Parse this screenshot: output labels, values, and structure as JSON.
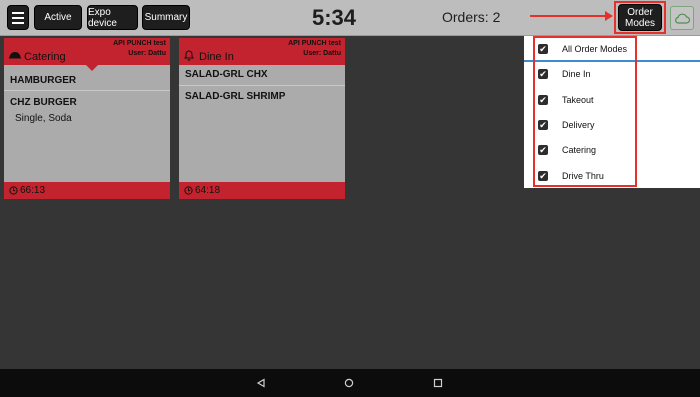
{
  "topbar": {
    "buttons": {
      "active": "Active",
      "expo": "Expo device",
      "summary": "Summary"
    },
    "clock": "5:34",
    "orders": "Orders: 2",
    "order_modes_line1": "Order",
    "order_modes_line2": "Modes"
  },
  "cards": [
    {
      "store": "API PUNCH test",
      "user": "User: Dattu",
      "mode": "Catering",
      "mode_icon": "catering-cloche-icon",
      "items": [
        {
          "name": "HAMBURGER"
        },
        {
          "name": "CHZ BURGER",
          "modifier": "Single, Soda"
        }
      ],
      "timer": "66:13"
    },
    {
      "store": "API PUNCH test",
      "user": "User: Dattu",
      "mode": "Dine In",
      "mode_icon": "bell-icon",
      "items": [
        {
          "name": "SALAD-GRL CHX"
        },
        {
          "name": "SALAD-GRL SHRIMP"
        }
      ],
      "timer": "64:18"
    }
  ],
  "order_modes": [
    {
      "label": "All Order Modes",
      "checked": true
    },
    {
      "label": "Dine In",
      "checked": true
    },
    {
      "label": "Takeout",
      "checked": true
    },
    {
      "label": "Delivery",
      "checked": true
    },
    {
      "label": "Catering",
      "checked": true
    },
    {
      "label": "Drive Thru",
      "checked": true
    }
  ],
  "colors": {
    "accent_red": "#c3232e",
    "highlight_red": "#e4312c",
    "divider_blue": "#3b8cd0"
  }
}
